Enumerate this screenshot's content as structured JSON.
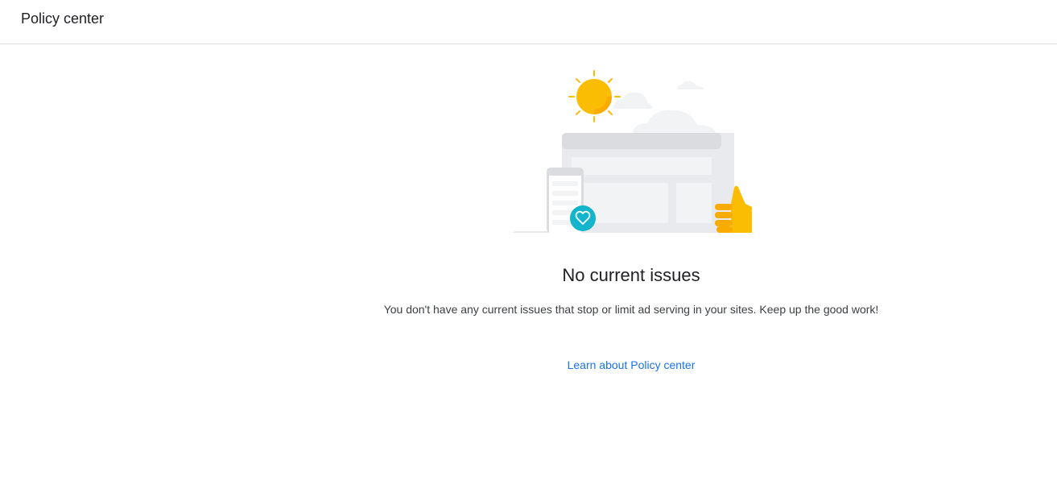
{
  "header": {
    "title": "Policy center"
  },
  "empty_state": {
    "title": "No current issues",
    "description": "You don't have any current issues that stop or limit ad serving in your sites. Keep up the good work!",
    "learn_link": "Learn about Policy center"
  },
  "colors": {
    "link": "#1a73e8",
    "sun": "#fbbc04",
    "thumb": "#fbbc04",
    "heart_badge": "#12b5cb",
    "browser_frame": "#dadce0",
    "browser_body": "#f1f3f4"
  },
  "illustration": {
    "icons": [
      "sun-icon",
      "cloud-icon",
      "browser-window-icon",
      "phone-icon",
      "heart-icon",
      "thumbs-up-icon"
    ]
  }
}
